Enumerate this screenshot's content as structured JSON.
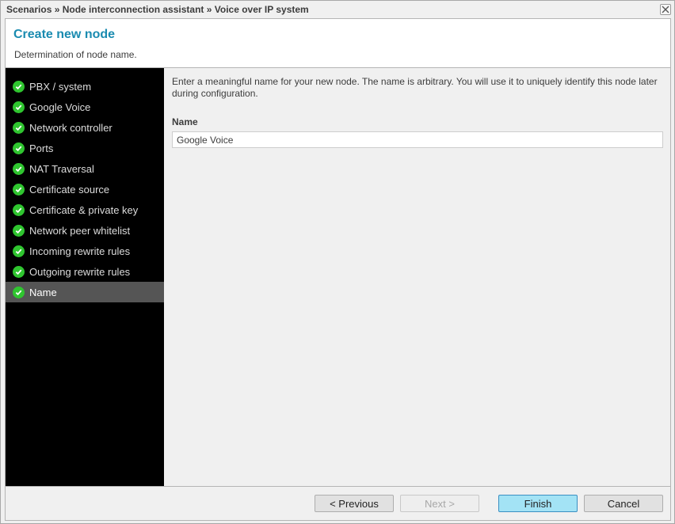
{
  "window": {
    "breadcrumb": "Scenarios » Node interconnection assistant » Voice over IP system",
    "close_icon": "close-x-icon"
  },
  "header": {
    "title": "Create new node",
    "subtitle": "Determination of node name."
  },
  "sidebar": {
    "steps": [
      {
        "label": "PBX / system",
        "status": "done"
      },
      {
        "label": "Google Voice",
        "status": "done"
      },
      {
        "label": "Network controller",
        "status": "done"
      },
      {
        "label": "Ports",
        "status": "done"
      },
      {
        "label": "NAT Traversal",
        "status": "done"
      },
      {
        "label": "Certificate source",
        "status": "done"
      },
      {
        "label": "Certificate & private key",
        "status": "done"
      },
      {
        "label": "Network peer whitelist",
        "status": "done"
      },
      {
        "label": "Incoming rewrite rules",
        "status": "done"
      },
      {
        "label": "Outgoing rewrite rules",
        "status": "done"
      },
      {
        "label": "Name",
        "status": "done",
        "active": true
      }
    ],
    "check_icon": "green-check-icon"
  },
  "content": {
    "description": "Enter a meaningful name for your new node. The name is arbitrary. You will use it to uniquely identify this node later during configuration.",
    "name_label": "Name",
    "name_value": "Google Voice"
  },
  "footer": {
    "previous_label": "< Previous",
    "next_label": "Next >",
    "finish_label": "Finish",
    "cancel_label": "Cancel"
  },
  "colors": {
    "accent_title": "#1a8bb0",
    "check_green": "#2fc52f",
    "finish_button": "#a3e3f5",
    "sidebar_bg": "#000000",
    "sidebar_active": "#555555"
  }
}
